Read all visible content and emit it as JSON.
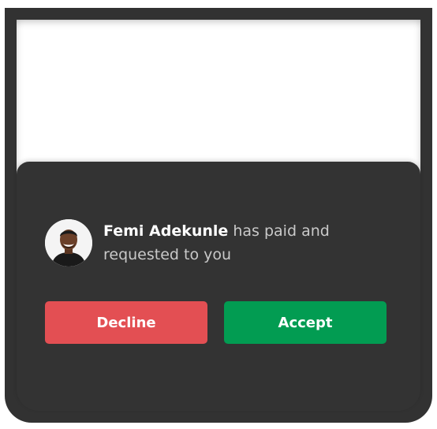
{
  "notification": {
    "sender_name": "Femi Adekunle",
    "message": "has paid and requested to you",
    "avatar_icon": "person-avatar"
  },
  "actions": {
    "decline_label": "Decline",
    "accept_label": "Accept"
  },
  "colors": {
    "frame": "#323232",
    "sheet": "#333333",
    "decline": "#e34f53",
    "accept": "#029c52"
  }
}
